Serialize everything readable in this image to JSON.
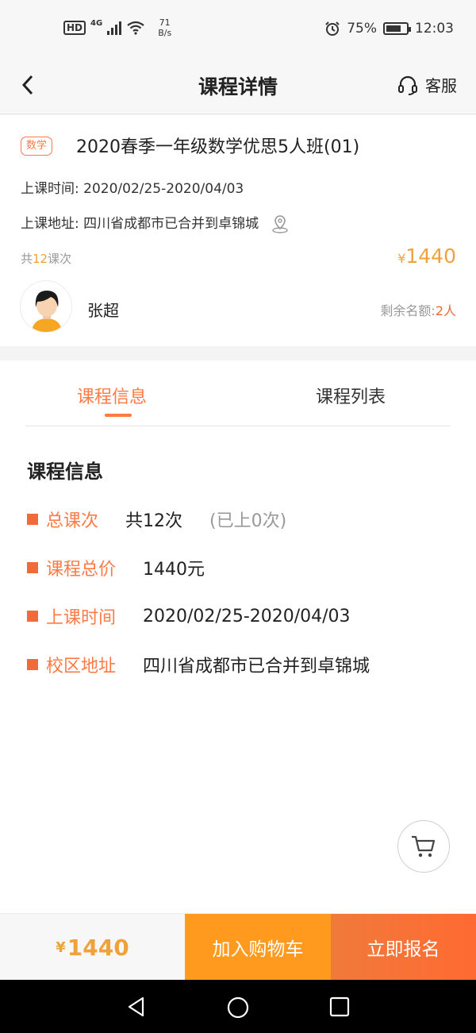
{
  "status_bar": {
    "hd": "HD",
    "network": "4G",
    "speed_value": "71",
    "speed_unit": "B/s",
    "battery": "75%",
    "time": "12:03"
  },
  "nav": {
    "title": "课程详情",
    "service_label": "客服"
  },
  "course": {
    "subject_tag": "数学",
    "name": "2020春季一年级数学优思5人班(01)",
    "time_label": "上课时间:",
    "time_value": "2020/02/25-2020/04/03",
    "address_label": "上课地址:",
    "address_value": "四川省成都市已合并到卓锦城",
    "lessons_prefix": "共",
    "lessons_count": "12",
    "lessons_suffix": "课次",
    "price_symbol": "¥",
    "price": "1440",
    "teacher": "张超",
    "remain_label": "剩余名额:",
    "remain_value": "2人"
  },
  "tabs": [
    {
      "label": "课程信息",
      "active": true
    },
    {
      "label": "课程列表",
      "active": false
    }
  ],
  "info": {
    "title": "课程信息",
    "rows": [
      {
        "label": "总课次",
        "value": "共12次",
        "extra": "(已上0次)"
      },
      {
        "label": "课程总价",
        "value": "1440元"
      },
      {
        "label": "上课时间",
        "value": "2020/02/25-2020/04/03"
      },
      {
        "label": "校区地址",
        "value": "四川省成都市已合并到卓锦城"
      }
    ]
  },
  "bottom": {
    "price_symbol": "¥",
    "price": "1440",
    "add_cart": "加入购物车",
    "enroll": "立即报名"
  },
  "colors": {
    "accent": "#ff7a45",
    "price": "#f0a23a",
    "cart_button": "#ff9a1f",
    "enroll_button": "#ff6a32"
  }
}
